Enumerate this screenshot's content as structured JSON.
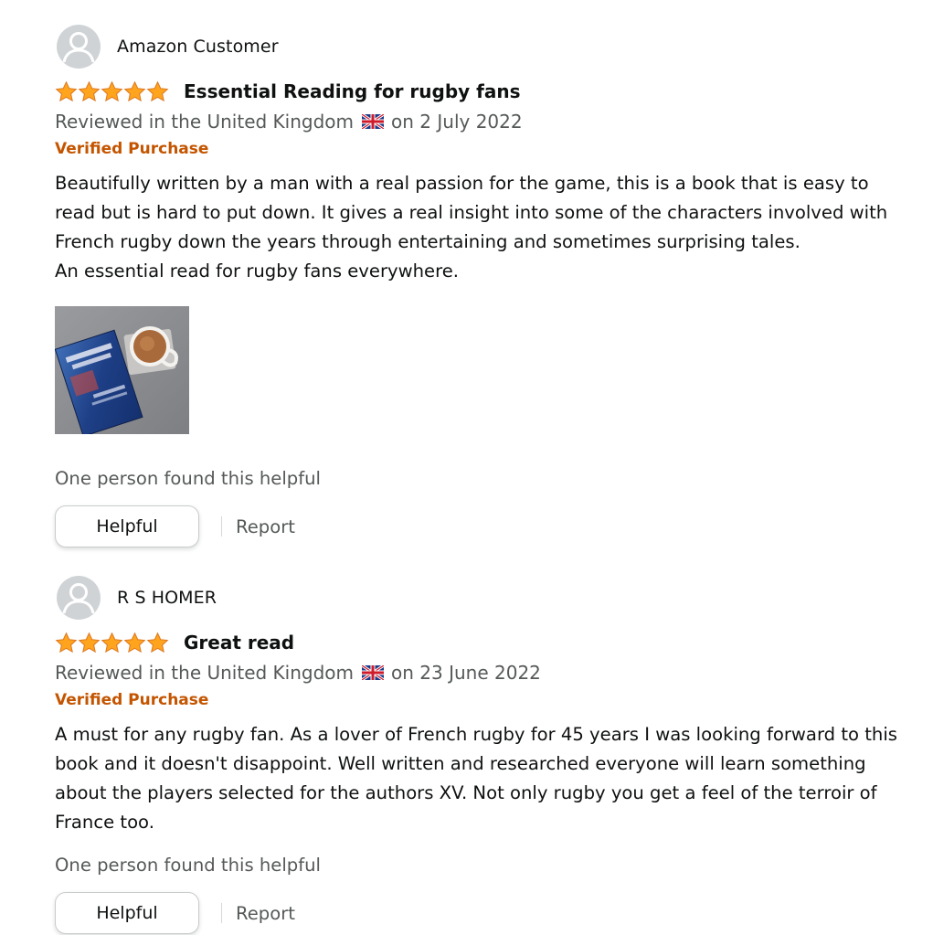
{
  "colors": {
    "star": "#ffa41c",
    "verified": "#c45500",
    "secondary_text": "#565959",
    "primary_text": "#0f1111"
  },
  "reviews": [
    {
      "author": "Amazon Customer",
      "rating": 5,
      "title": "Essential Reading for rugby fans",
      "reviewed_in": "Reviewed in the United Kingdom",
      "flag_icon": "uk-flag-icon",
      "date": "on 2 July 2022",
      "verified": "Verified Purchase",
      "body": [
        "Beautifully written by a man with a real passion for the game, this is a book that is easy to read but is hard to put down. It gives a real insight into some of the characters involved with French rugby down the years through entertaining and sometimes surprising tales.",
        "An essential read for rugby fans everywhere."
      ],
      "has_photo": true,
      "helpful_count": "One person found this helpful",
      "helpful_label": "Helpful",
      "report_label": "Report"
    },
    {
      "author": "R S HOMER",
      "rating": 5,
      "title": "Great read",
      "reviewed_in": "Reviewed in the United Kingdom",
      "flag_icon": "uk-flag-icon",
      "date": "on 23 June 2022",
      "verified": "Verified Purchase",
      "body": [
        "A must for any rugby fan. As a lover of French rugby for 45 years I was looking forward to this book and it doesn't disappoint. Well written and researched everyone will learn something about the players selected for the authors XV. Not only rugby you get a feel of the terroir of France too."
      ],
      "has_photo": false,
      "helpful_count": "One person found this helpful",
      "helpful_label": "Helpful",
      "report_label": "Report"
    }
  ]
}
